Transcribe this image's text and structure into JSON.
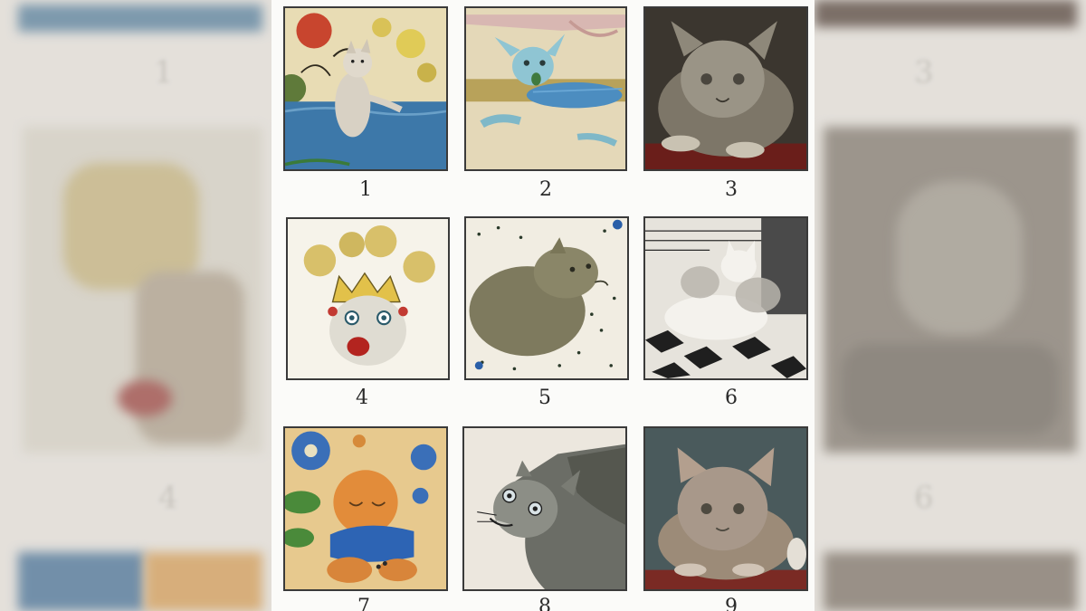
{
  "image": {
    "subject": "medieval-cat-paintings-grid",
    "labels": [
      "1",
      "2",
      "3",
      "4",
      "5",
      "6",
      "7",
      "8",
      "9"
    ]
  }
}
